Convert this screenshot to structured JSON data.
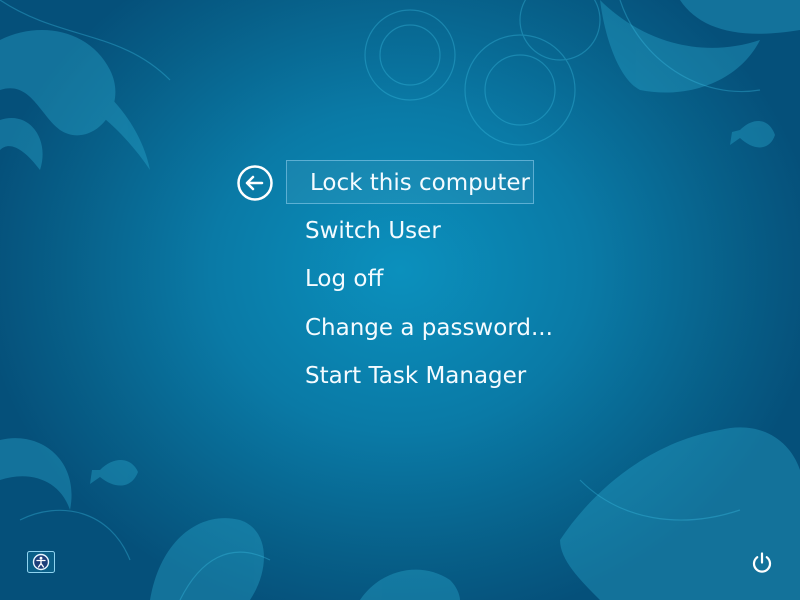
{
  "menu": {
    "items": [
      {
        "label": "Lock this computer",
        "selected": true
      },
      {
        "label": "Switch User"
      },
      {
        "label": "Log off"
      },
      {
        "label": "Change a password..."
      },
      {
        "label": "Start Task Manager"
      }
    ]
  },
  "icons": {
    "back": "back-arrow-icon",
    "ease_of_access": "ease-of-access-icon",
    "power": "power-icon"
  },
  "colors": {
    "background_center": "#0b90bd",
    "background_edge": "#05507a",
    "text": "#ffffff"
  }
}
